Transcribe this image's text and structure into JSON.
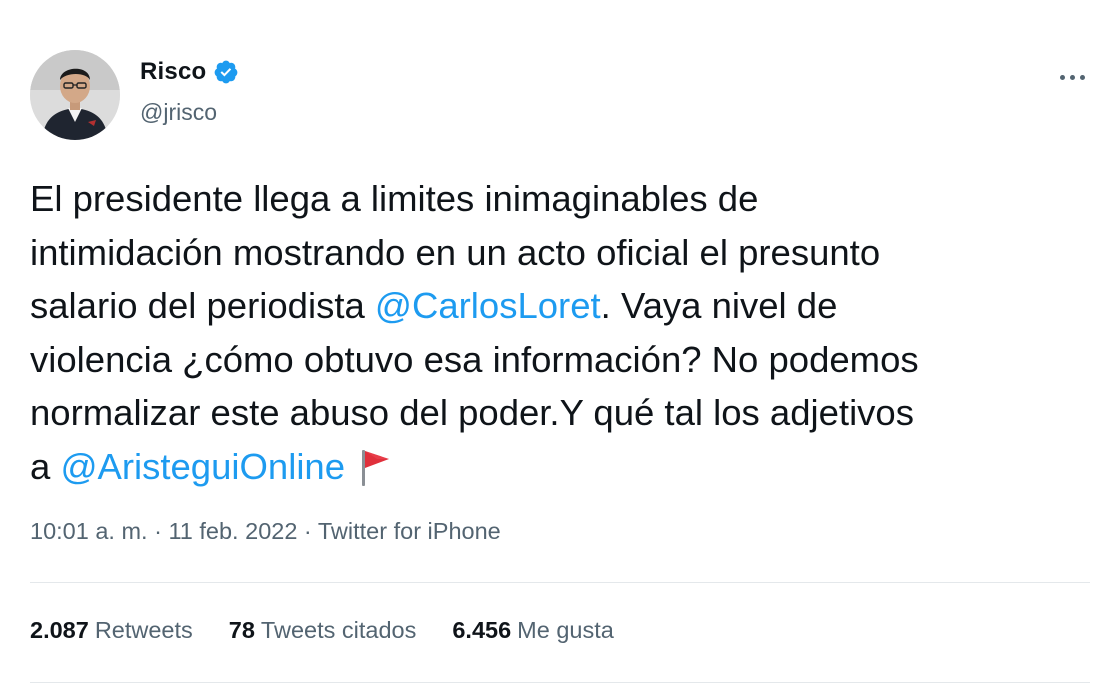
{
  "author": {
    "name": "Risco",
    "handle": "@jrisco",
    "verified": true
  },
  "tweet": {
    "text_1": "El presidente llega a limites inimaginables de\nintimidación mostrando en un acto oficial el presunto\nsalario del periodista ",
    "mention_1": "@CarlosLoret",
    "text_2": ". Vaya nivel de\nviolencia ¿cómo obtuvo esa información? No podemos\nnormalizar este abuso del poder.Y qué tal los adjetivos\na ",
    "mention_2": "@AristeguiOnline",
    "emoji": "red-triangular-flag-icon"
  },
  "meta": {
    "time": "10:01 a. m.",
    "separator": " · ",
    "date": "11 feb. 2022",
    "source": "Twitter for iPhone"
  },
  "stats": {
    "retweets_count": "2.087",
    "retweets_label": "Retweets",
    "quotes_count": "78",
    "quotes_label": "Tweets citados",
    "likes_count": "6.456",
    "likes_label": "Me gusta"
  },
  "colors": {
    "link": "#1d9bf0",
    "text": "#0f1419",
    "secondary": "#536471",
    "verified": "#1d9bf0",
    "divider": "#e4e8eb"
  }
}
